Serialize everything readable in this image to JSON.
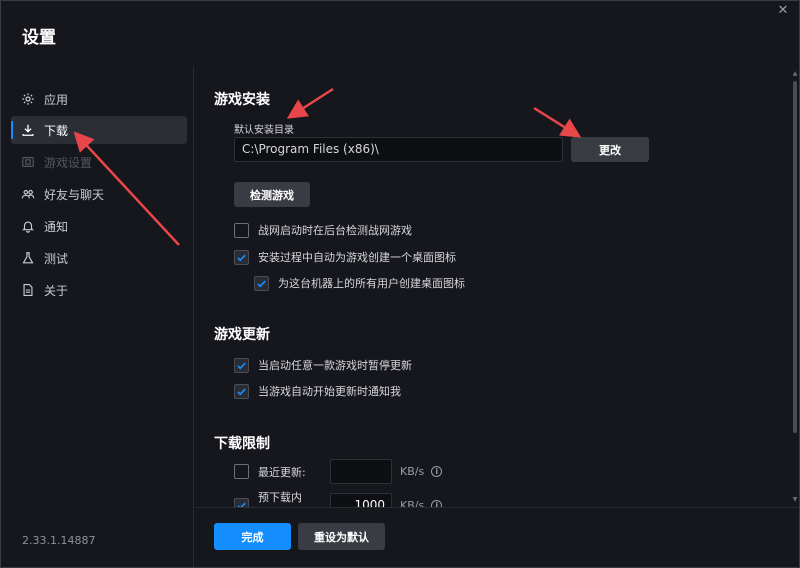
{
  "window": {
    "title": "设置"
  },
  "sidebar": {
    "items": [
      {
        "label": "应用",
        "icon": "gear-icon"
      },
      {
        "label": "下载",
        "icon": "download-icon"
      },
      {
        "label": "游戏设置",
        "icon": "gamepad-icon"
      },
      {
        "label": "好友与聊天",
        "icon": "users-icon"
      },
      {
        "label": "通知",
        "icon": "bell-icon"
      },
      {
        "label": "测试",
        "icon": "flask-icon"
      },
      {
        "label": "关于",
        "icon": "document-icon"
      }
    ],
    "version": "2.33.1.14887"
  },
  "install": {
    "title": "游戏安装",
    "dir_label": "默认安装目录",
    "dir_value": "C:\\Program Files (x86)\\",
    "change_button": "更改",
    "detect_button": "检测游戏",
    "options": [
      {
        "label": "战网启动时在后台检测战网游戏",
        "checked": false
      },
      {
        "label": "安装过程中自动为游戏创建一个桌面图标",
        "checked": true
      },
      {
        "label": "为这台机器上的所有用户创建桌面图标",
        "checked": true
      }
    ]
  },
  "update": {
    "title": "游戏更新",
    "options": [
      {
        "label": "当启动任意一款游戏时暂停更新",
        "checked": true
      },
      {
        "label": "当游戏自动开始更新时通知我",
        "checked": true
      }
    ]
  },
  "limits": {
    "title": "下载限制",
    "rows": [
      {
        "label": "最近更新:",
        "checked": false,
        "value": "",
        "unit": "KB/s"
      },
      {
        "label": "预下载内容:",
        "checked": true,
        "value": "1000",
        "unit": "KB/s"
      }
    ]
  },
  "footer": {
    "done_button": "完成",
    "reset_button": "重设为默认"
  },
  "colors": {
    "accent": "#148eff",
    "annotation": "#e8474a"
  }
}
